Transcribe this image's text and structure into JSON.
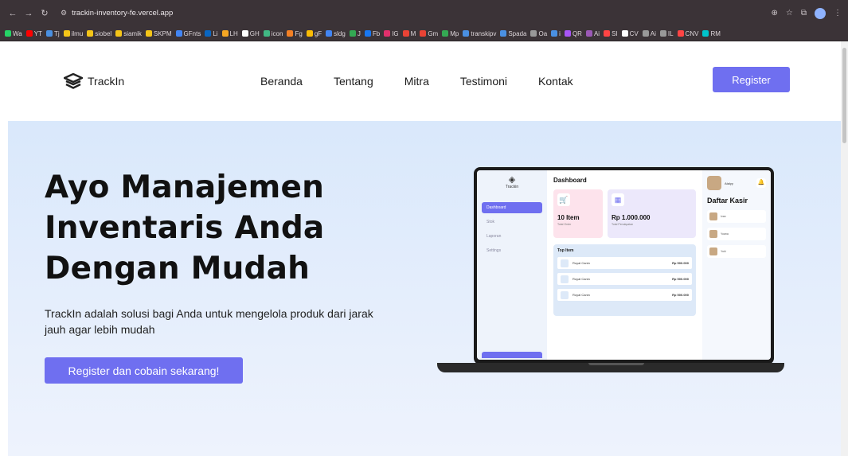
{
  "browser": {
    "url": "trackin-inventory-fe.vercel.app",
    "bookmarks": [
      "Wa",
      "YT",
      "Tj",
      "ilmu",
      "siobel",
      "siamik",
      "SKPM",
      "GFnts",
      "Li",
      "LH",
      "GH",
      "icon",
      "Fg",
      "gF",
      "sldg",
      "J",
      "Fb",
      "IG",
      "M",
      "Gm",
      "Mp",
      "transkipv",
      "Spada",
      "Oa",
      "i",
      "QR",
      "Ai",
      "SI",
      "CV",
      "Ai",
      "IL",
      "CNV",
      "RM"
    ]
  },
  "header": {
    "brand": "TrackIn",
    "nav": [
      "Beranda",
      "Tentang",
      "Mitra",
      "Testimoni",
      "Kontak"
    ],
    "register_label": "Register"
  },
  "hero": {
    "title": "Ayo Manajemen Inventaris Anda Dengan Mudah",
    "description": "TrackIn adalah solusi bagi Anda untuk mengelola produk dari jarak jauh agar lebih mudah",
    "cta_label": "Register dan cobain sekarang!"
  },
  "mockup": {
    "brand": "Trackin",
    "menu": [
      "Dashboard",
      "Stok",
      "Laporan",
      "Settings"
    ],
    "title": "Dashboard",
    "card1_value": "10 Item",
    "card1_sub": "Total Order",
    "card2_value": "Rp 1.000.000",
    "card2_sub": "Total Pendapatan",
    "top_title": "Top Item",
    "top_items": [
      {
        "name": "Royal Canin",
        "price": "Rp 500.000"
      },
      {
        "name": "Royal Canin",
        "price": "Rp 500.000"
      },
      {
        "name": "Royal Canin",
        "price": "Rp 500.000"
      }
    ],
    "user_name": "Atalyy",
    "kasir_title": "Daftar Kasir",
    "kasir": [
      "Ivan",
      "Yoana",
      "Yuki"
    ]
  },
  "colors": {
    "accent": "#6f6ff0",
    "hero_bg": "#dfeafb",
    "chrome_bg": "#3b3337"
  }
}
